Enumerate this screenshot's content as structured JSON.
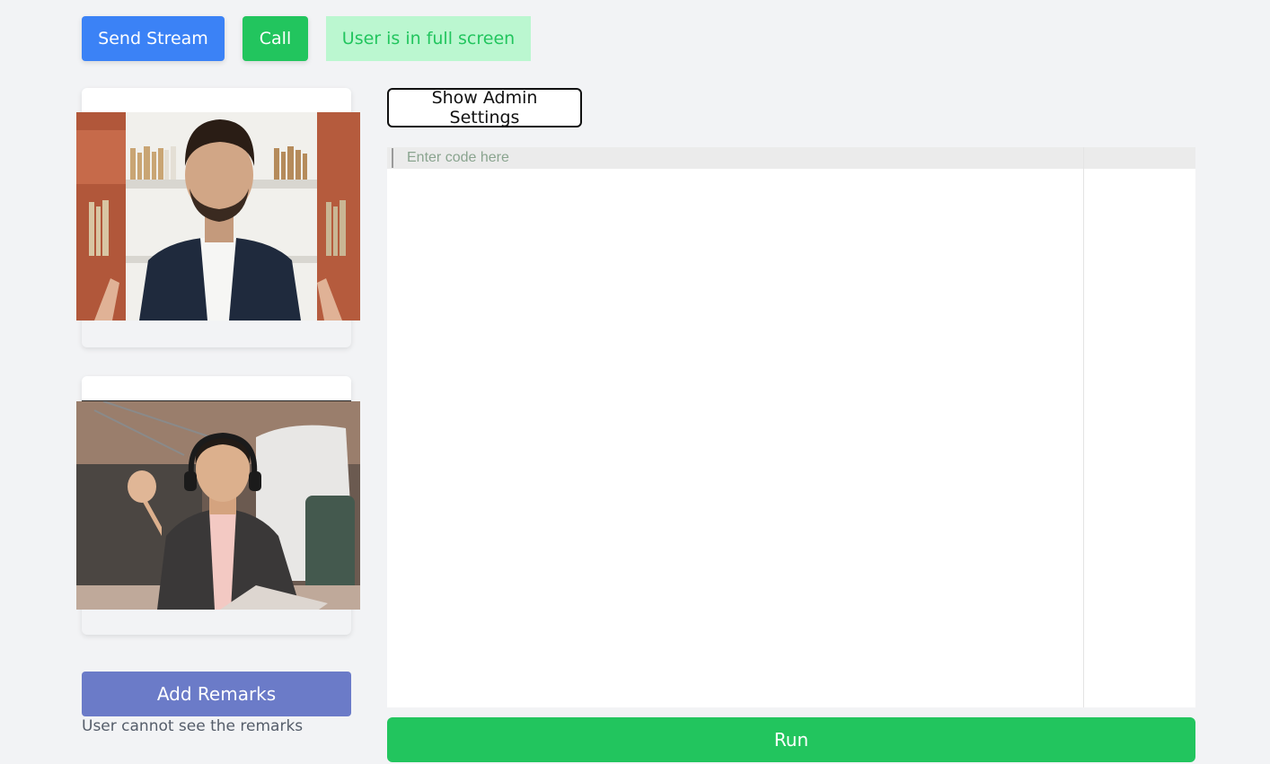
{
  "toolbar": {
    "send_stream_label": "Send Stream",
    "call_label": "Call",
    "status_text": "User is in full screen"
  },
  "admin": {
    "toggle_label": "Show Admin Settings"
  },
  "editor": {
    "placeholder": "Enter code here",
    "value": ""
  },
  "remarks": {
    "button_label": "Add Remarks",
    "note": "User cannot see the remarks"
  },
  "run": {
    "button_label": "Run"
  },
  "colors": {
    "background": "#f2f3f5",
    "primary_blue": "#3b82f6",
    "success_green": "#22c55e",
    "status_badge_bg": "#bbf7d0",
    "remarks_purple": "#6b7bc8"
  }
}
